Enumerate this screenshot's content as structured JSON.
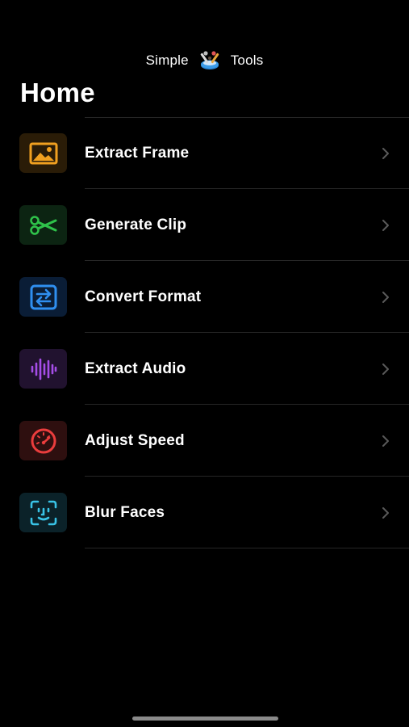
{
  "header": {
    "left_word": "Simple",
    "right_word": "Tools",
    "logo_icon": "toolbox-logo-icon"
  },
  "page": {
    "title": "Home"
  },
  "menu": {
    "items": [
      {
        "label": "Extract Frame",
        "icon": "image-icon",
        "color": "#f0a020",
        "tile_bg": "#2a1c07"
      },
      {
        "label": "Generate Clip",
        "icon": "scissors-icon",
        "color": "#2fc24a",
        "tile_bg": "#0c2412"
      },
      {
        "label": "Convert Format",
        "icon": "convert-arrows-icon",
        "color": "#2f8ff0",
        "tile_bg": "#0a1d36"
      },
      {
        "label": "Extract Audio",
        "icon": "waveform-icon",
        "color": "#a64de8",
        "tile_bg": "#21122f"
      },
      {
        "label": "Adjust Speed",
        "icon": "speedometer-icon",
        "color": "#ea3d3d",
        "tile_bg": "#2e0f0f"
      },
      {
        "label": "Blur Faces",
        "icon": "face-id-icon",
        "color": "#39c3e6",
        "tile_bg": "#0b2229"
      }
    ]
  },
  "colors": {
    "background": "#000000",
    "separator": "#262626",
    "chevron": "#5a5a5a",
    "text": "#ffffff"
  }
}
